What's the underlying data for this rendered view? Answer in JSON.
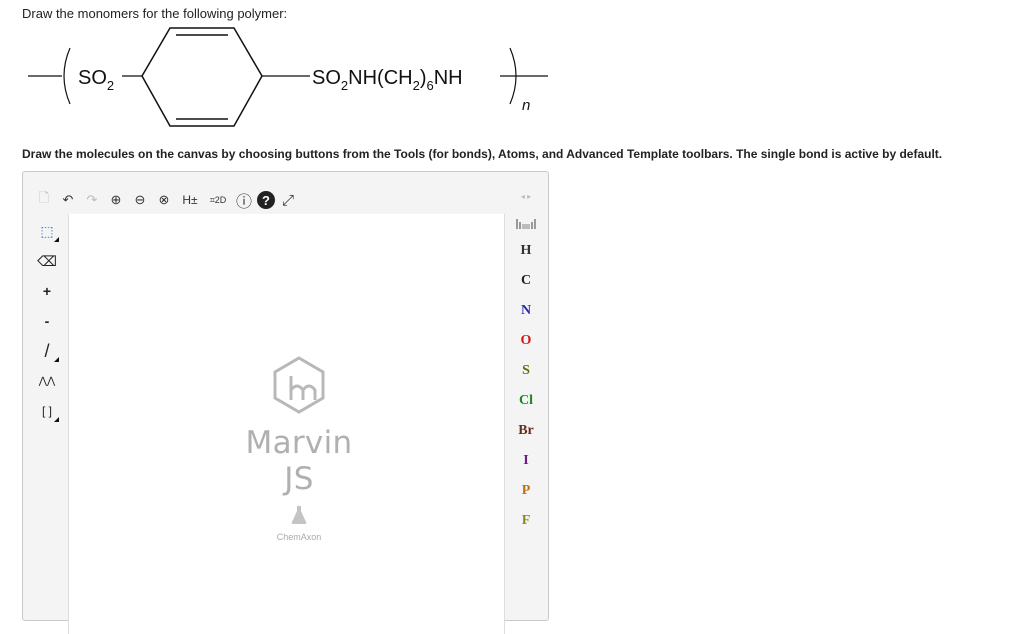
{
  "question": {
    "prompt": "Draw the monomers for the following polymer:",
    "polymer": {
      "left_group": "SO",
      "left_sub": "2",
      "right_a": "SO",
      "right_a_sub": "2",
      "right_b": "NH(CH",
      "right_b_sub": "2",
      "right_c": ")",
      "right_c_sub": "6",
      "right_d": "NH",
      "repeat": "n"
    },
    "instructions": "Draw the molecules on the canvas by choosing buttons from the Tools (for bonds), Atoms, and Advanced Template toolbars. The single bond is active by default."
  },
  "editor": {
    "top_toolbar": [
      {
        "name": "new-document-icon",
        "glyph": "🗋",
        "dim": true
      },
      {
        "name": "undo-icon",
        "glyph": "↶"
      },
      {
        "name": "redo-icon",
        "glyph": "↷",
        "dim": true
      },
      {
        "name": "zoom-in-icon",
        "glyph": "⊕"
      },
      {
        "name": "zoom-out-icon",
        "glyph": "⊖"
      },
      {
        "name": "zoom-reset-icon",
        "glyph": "⊗"
      },
      {
        "name": "hydrogen-toggle-icon",
        "glyph": "H±"
      },
      {
        "name": "clean-2d-icon",
        "glyph": "⌗2D"
      },
      {
        "name": "info-icon",
        "glyph": "ⓘ"
      },
      {
        "name": "help-icon",
        "glyph": "?"
      },
      {
        "name": "fullscreen-icon",
        "glyph": "⤢"
      }
    ],
    "left_toolbar": [
      {
        "name": "selection-tool-icon",
        "glyph": "⬚"
      },
      {
        "name": "eraser-tool-icon",
        "glyph": "⌫"
      },
      {
        "name": "increase-charge-icon",
        "glyph": "+"
      },
      {
        "name": "decrease-charge-icon",
        "glyph": "-"
      },
      {
        "name": "single-bond-tool-icon",
        "glyph": "/"
      },
      {
        "name": "chain-tool-icon",
        "glyph": "⋀⋀"
      },
      {
        "name": "sgroup-bracket-icon",
        "glyph": "[ ]"
      }
    ],
    "logo": {
      "name": "Marvin JS",
      "company": "ChemAxon"
    },
    "atoms": [
      {
        "symbol": "H",
        "color": "#333333"
      },
      {
        "symbol": "C",
        "color": "#222222"
      },
      {
        "symbol": "N",
        "color": "#2a2ab0"
      },
      {
        "symbol": "O",
        "color": "#d01818"
      },
      {
        "symbol": "S",
        "color": "#6b6b00"
      },
      {
        "symbol": "Cl",
        "color": "#1a8a1a"
      },
      {
        "symbol": "Br",
        "color": "#6b2b1a"
      },
      {
        "symbol": "I",
        "color": "#6a1a8a"
      },
      {
        "symbol": "P",
        "color": "#c07010"
      },
      {
        "symbol": "F",
        "color": "#8a8a20"
      }
    ]
  }
}
